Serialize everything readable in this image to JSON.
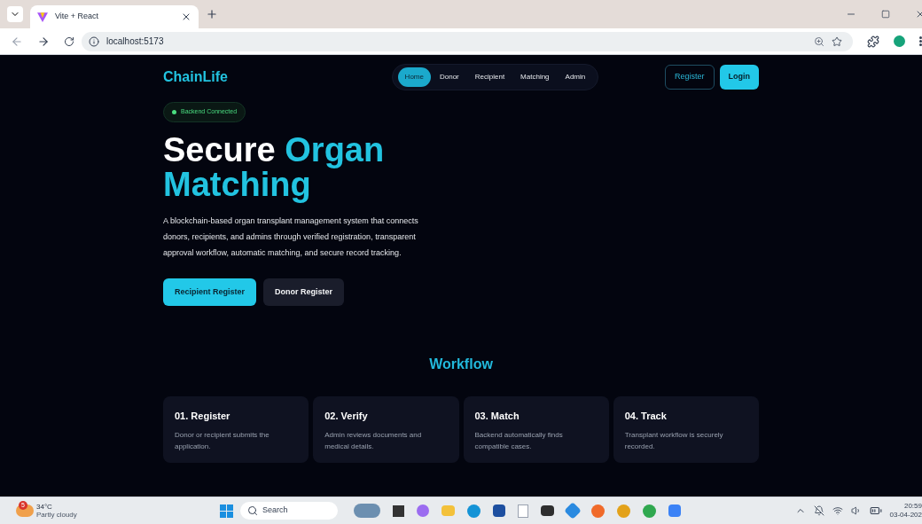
{
  "browser": {
    "tab_title": "Vite + React",
    "url": "localhost:5173"
  },
  "nav": {
    "brand": "ChainLife",
    "links": [
      {
        "label": "Home",
        "selected": true
      },
      {
        "label": "Donor",
        "selected": false
      },
      {
        "label": "Recipient",
        "selected": false
      },
      {
        "label": "Matching",
        "selected": false
      },
      {
        "label": "Admin",
        "selected": false
      }
    ],
    "register": "Register",
    "login": "Login"
  },
  "hero": {
    "status": {
      "label": "Backend Connected",
      "connected": true
    },
    "title_plain": "Secure",
    "title_accent": "Organ Matching",
    "description": "A blockchain-based organ transplant management system that connects donors, recipients, and admins through verified registration, transparent approval workflow, automatic matching, and secure record tracking.",
    "buttons": [
      {
        "label": "Recipient Register",
        "kind": "primary"
      },
      {
        "label": "Donor Register",
        "kind": "secondary"
      }
    ]
  },
  "workflow": {
    "heading": "Workflow",
    "steps": [
      {
        "title": "01. Register",
        "description": "Donor or recipient submits the application."
      },
      {
        "title": "02. Verify",
        "description": "Admin reviews documents and medical details."
      },
      {
        "title": "03. Match",
        "description": "Backend automatically finds compatible cases."
      },
      {
        "title": "04. Track",
        "description": "Transplant workflow is securely recorded."
      }
    ]
  },
  "taskbar": {
    "weather": {
      "badge": "5",
      "temperature": "34°C",
      "condition": "Partly cloudy"
    },
    "search": "Search",
    "time": "20:59",
    "date": "03-04-202"
  }
}
